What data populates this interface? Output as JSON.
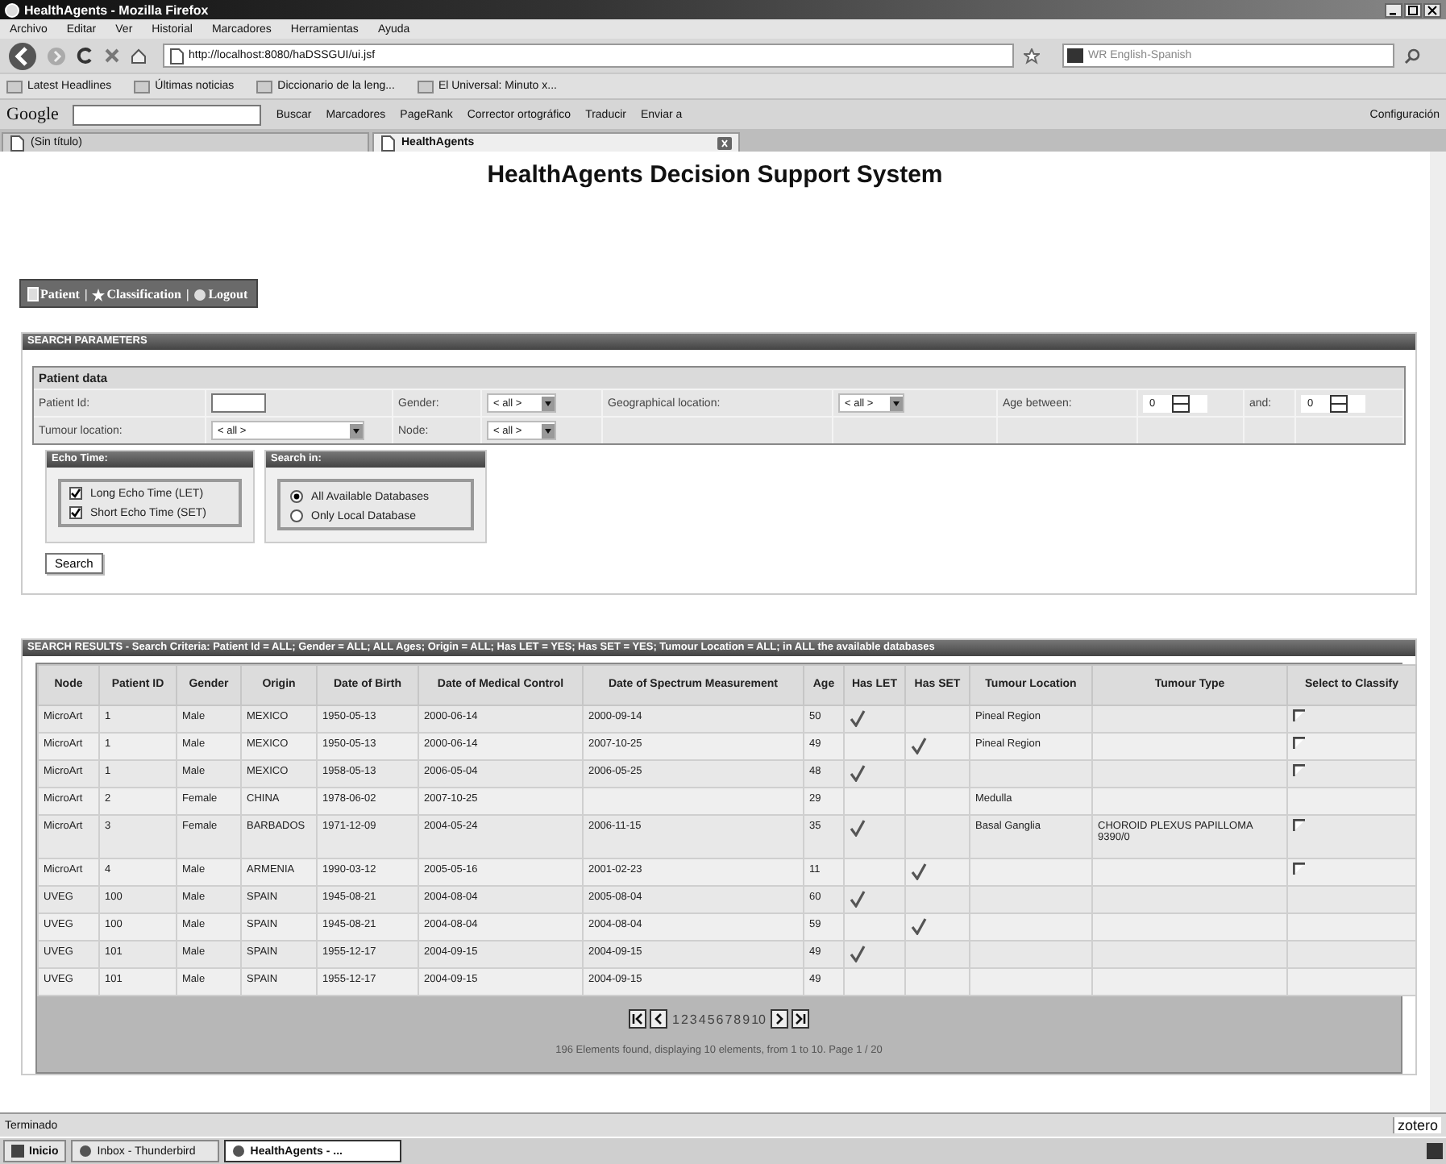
{
  "window": {
    "title": "HealthAgents - Mozilla Firefox"
  },
  "menu": [
    "Archivo",
    "Editar",
    "Ver",
    "Historial",
    "Marcadores",
    "Herramientas",
    "Ayuda"
  ],
  "navigation": {
    "url": "http://localhost:8080/haDSSGUI/ui.jsf",
    "search_placeholder": "WR English-Spanish"
  },
  "bookmarks": [
    "Latest Headlines",
    "Últimas noticias",
    "Diccionario de la leng...",
    "El Universal: Minuto x..."
  ],
  "google_toolbar": {
    "logo": "Google",
    "items": [
      "Buscar",
      "Marcadores",
      "PageRank",
      "Corrector ortográfico",
      "Traducir",
      "Enviar a"
    ],
    "settings": "Configuración"
  },
  "tabs": [
    {
      "label": "(Sin título)",
      "selected": false
    },
    {
      "label": "HealthAgents",
      "selected": true
    }
  ],
  "page": {
    "title": "HealthAgents Decision Support System",
    "nav": [
      {
        "kind": "link",
        "label": "Patient"
      },
      {
        "kind": "sep",
        "label": "|"
      },
      {
        "kind": "link",
        "label": "Classification"
      },
      {
        "kind": "sep",
        "label": "|"
      },
      {
        "kind": "link",
        "label": "Logout"
      }
    ]
  },
  "search_parameters": {
    "title": "SEARCH PARAMETERS",
    "section": "Patient data",
    "patient_id": {
      "label": "Patient Id:"
    },
    "gender": {
      "label": "Gender:",
      "value": "< all >"
    },
    "geo": {
      "label": "Geographical location:",
      "value": "< all >"
    },
    "age_from": {
      "label": "Age between:",
      "value": "0"
    },
    "age_to": {
      "label": "and:",
      "value": "0"
    },
    "tumour_location": {
      "label": "Tumour location:",
      "value": "< all >"
    },
    "node": {
      "label": "Node:",
      "value": "< all >"
    },
    "echo_time": {
      "title": "Echo Time:",
      "options": [
        {
          "label": "Long Echo Time (LET)",
          "checked": true
        },
        {
          "label": "Short Echo Time (SET)",
          "checked": true
        }
      ]
    },
    "search_in": {
      "title": "Search in:",
      "options": [
        {
          "label": "All Available Databases",
          "selected": true
        },
        {
          "label": "Only Local Database",
          "selected": false
        }
      ]
    },
    "button": "Search"
  },
  "results": {
    "title": "SEARCH RESULTS - Search Criteria: Patient Id = ALL; Gender = ALL; ALL Ages; Origin = ALL; Has LET = YES; Has SET = YES; Tumour Location = ALL; in ALL the available databases",
    "columns": [
      "Node",
      "Patient ID",
      "Gender",
      "Origin",
      "Date of Birth",
      "Date of Medical Control",
      "Date of Spectrum Measurement",
      "Age",
      "Has LET",
      "Has SET",
      "Tumour Location",
      "Tumour Type",
      "Select to Classify"
    ],
    "rows": [
      {
        "node": "MicroArt",
        "patient_id": "1",
        "gender": "Male",
        "origin": "MEXICO",
        "birth": "1950-05-13",
        "control": "2000-06-14",
        "measurement": "2000-09-14",
        "age": "50",
        "has_let": true,
        "has_set": false,
        "location": "Pineal Region",
        "selectable": true
      },
      {
        "node": "MicroArt",
        "patient_id": "1",
        "gender": "Male",
        "origin": "MEXICO",
        "birth": "1950-05-13",
        "control": "2000-06-14",
        "measurement": "2007-10-25",
        "age": "49",
        "has_let": false,
        "has_set": true,
        "location": "Pineal Region",
        "selectable": true
      },
      {
        "node": "MicroArt",
        "patient_id": "1",
        "gender": "Male",
        "origin": "MEXICO",
        "birth": "1958-05-13",
        "control": "2006-05-04",
        "measurement": "2006-05-25",
        "age": "48",
        "has_let": true,
        "has_set": false,
        "selectable": true
      },
      {
        "node": "MicroArt",
        "patient_id": "2",
        "gender": "Female",
        "origin": "CHINA",
        "birth": "1978-06-02",
        "control": "2007-10-25",
        "age": "29",
        "has_let": false,
        "has_set": false,
        "location": "Medulla",
        "selectable": false
      },
      {
        "node": "MicroArt",
        "patient_id": "3",
        "gender": "Female",
        "origin": "BARBADOS",
        "birth": "1971-12-09",
        "control": "2004-05-24",
        "measurement": "2006-11-15",
        "age": "35",
        "has_let": true,
        "has_set": false,
        "location": "Basal Ganglia",
        "type": "CHOROID PLEXUS PAPILLOMA 9390/0",
        "selectable": true
      },
      {
        "node": "MicroArt",
        "patient_id": "4",
        "gender": "Male",
        "origin": "ARMENIA",
        "birth": "1990-03-12",
        "control": "2005-05-16",
        "measurement": "2001-02-23",
        "age": "11",
        "has_let": false,
        "has_set": true,
        "selectable": true
      },
      {
        "node": "UVEG",
        "patient_id": "100",
        "gender": "Male",
        "origin": "SPAIN",
        "birth": "1945-08-21",
        "control": "2004-08-04",
        "measurement": "2005-08-04",
        "age": "60",
        "has_let": true,
        "has_set": false,
        "selectable": false
      },
      {
        "node": "UVEG",
        "patient_id": "100",
        "gender": "Male",
        "origin": "SPAIN",
        "birth": "1945-08-21",
        "control": "2004-08-04",
        "measurement": "2004-08-04",
        "age": "59",
        "has_let": false,
        "has_set": true,
        "selectable": false
      },
      {
        "node": "UVEG",
        "patient_id": "101",
        "gender": "Male",
        "origin": "SPAIN",
        "birth": "1955-12-17",
        "control": "2004-09-15",
        "measurement": "2004-09-15",
        "age": "49",
        "has_let": true,
        "has_set": false,
        "selectable": false
      },
      {
        "node": "UVEG",
        "patient_id": "101",
        "gender": "Male",
        "origin": "SPAIN",
        "birth": "1955-12-17",
        "control": "2004-09-15",
        "measurement": "2004-09-15",
        "age": "49",
        "has_let": false,
        "has_set": false,
        "selectable": false
      }
    ],
    "pages": [
      "1",
      "2",
      "3",
      "4",
      "5",
      "6",
      "7",
      "8",
      "9",
      "10"
    ],
    "summary": "196 Elements found, displaying 10 elements, from 1 to 10. Page 1 / 20"
  },
  "status_bar": {
    "text": "Terminado",
    "addon": "zotero"
  },
  "taskbar": {
    "start": "Inicio",
    "items": [
      {
        "label": "Inbox - Thunderbird",
        "selected": false
      },
      {
        "label": "HealthAgents - ...",
        "selected": true
      }
    ]
  }
}
